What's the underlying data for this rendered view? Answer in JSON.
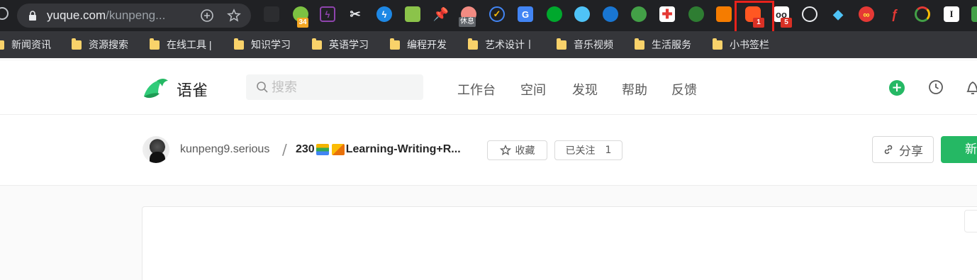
{
  "browser": {
    "url_host": "yuque.com",
    "url_path": "/kunpeng...",
    "extensions": [
      {
        "name": "puzzle-dark-icon",
        "badge": ""
      },
      {
        "name": "frog-icon",
        "badge": "34"
      },
      {
        "name": "purple-bolt-icon",
        "badge": ""
      },
      {
        "name": "scissors-icon",
        "badge": ""
      },
      {
        "name": "blue-lightning-icon",
        "badge": ""
      },
      {
        "name": "landscape-icon",
        "badge": ""
      },
      {
        "name": "pin-icon",
        "badge": ""
      },
      {
        "name": "rest-icon",
        "badge": "休息"
      },
      {
        "name": "check-circle-icon",
        "badge": ""
      },
      {
        "name": "google-translate-icon",
        "badge": ""
      },
      {
        "name": "evernote-icon",
        "badge": ""
      },
      {
        "name": "bowl-icon",
        "badge": ""
      },
      {
        "name": "signal-icon",
        "badge": ""
      },
      {
        "name": "eye-icon",
        "badge": ""
      },
      {
        "name": "red-cross-icon",
        "badge": ""
      },
      {
        "name": "green-pie-icon",
        "badge": ""
      },
      {
        "name": "rss-icon",
        "badge": ""
      },
      {
        "name": "orange-box-icon",
        "badge": "1"
      },
      {
        "name": "glasses-icon",
        "badge": "5"
      },
      {
        "name": "speedometer-icon",
        "badge": ""
      },
      {
        "name": "diamond-icon",
        "badge": ""
      },
      {
        "name": "infinity-icon",
        "badge": ""
      },
      {
        "name": "flash-icon",
        "badge": ""
      },
      {
        "name": "refresh-circle-icon",
        "badge": ""
      },
      {
        "name": "text-i-icon",
        "badge": ""
      },
      {
        "name": "green-square-icon",
        "badge": ""
      }
    ]
  },
  "bookmarks": [
    "新闻资讯",
    "资源搜索",
    "在线工具 |",
    "知识学习",
    "英语学习",
    "编程开发",
    "艺术设计丨",
    "音乐视频",
    "生活服务",
    "小书签栏"
  ],
  "header": {
    "logo_text": "语雀",
    "search_placeholder": "搜索",
    "nav": [
      "工作台",
      "空间",
      "发现",
      "帮助",
      "反馈"
    ],
    "plus_label": "+"
  },
  "book": {
    "owner": "kunpeng9.serious",
    "separator": "/",
    "title_prefix": "230",
    "title_text": "Learning-Writing+R...",
    "star_label": "收藏",
    "follow_label": "已关注",
    "follow_count": "1",
    "share_label": "分享",
    "new_label": "新"
  }
}
